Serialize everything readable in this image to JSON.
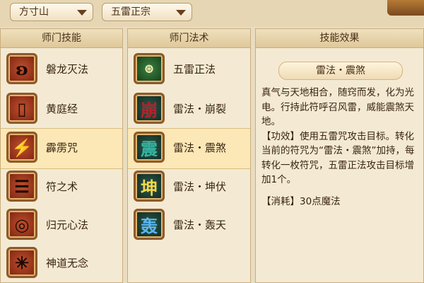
{
  "header": {
    "school_dropdown": "方寸山",
    "skill_dropdown": "五雷正宗"
  },
  "panels": {
    "school_skills": {
      "title": "师门技能",
      "items": [
        {
          "label": "磐龙灭法",
          "icon": "dragon-rune-icon"
        },
        {
          "label": "黄庭经",
          "icon": "scroll-book-icon"
        },
        {
          "label": "霹雳咒",
          "icon": "thunder-rune-icon",
          "selected": true
        },
        {
          "label": "符之术",
          "icon": "talisman-rune-icon"
        },
        {
          "label": "归元心法",
          "icon": "spiral-seal-icon"
        },
        {
          "label": "神道无念",
          "icon": "branch-rune-icon"
        }
      ]
    },
    "school_spells": {
      "title": "师门法术",
      "items": [
        {
          "label": "五雷正法",
          "icon": "five-thunder-icon"
        },
        {
          "label": "雷法・崩裂",
          "icon": "beng-glyph-icon",
          "glyph": "崩"
        },
        {
          "label": "雷法・震煞",
          "icon": "zhen-glyph-icon",
          "glyph": "震",
          "selected": true
        },
        {
          "label": "雷法・坤伏",
          "icon": "kun-glyph-icon",
          "glyph": "坤"
        },
        {
          "label": "雷法・轰天",
          "icon": "hong-glyph-icon",
          "glyph": "轰"
        }
      ]
    },
    "skill_effect": {
      "title": "技能效果",
      "skill_name": "雷法・震煞",
      "description": "真气与天地相合，随窍而发，化为光电。行持此符呼召风雷，威能震煞天地。",
      "effect": "【功效】使用五雷咒攻击目标。转化当前的符咒为“雷法・震煞”加持，每转化一枚符咒，五雷正法攻击目标增加1个。",
      "cost": "【消耗】30点魔法"
    }
  }
}
